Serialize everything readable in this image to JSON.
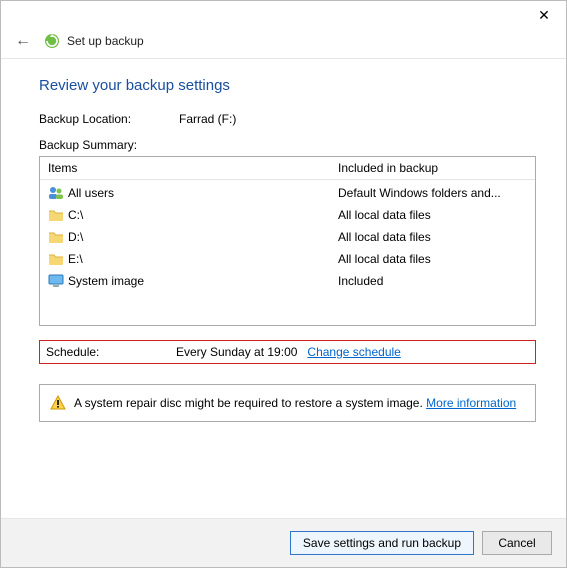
{
  "window": {
    "title": "Set up backup"
  },
  "page": {
    "title": "Review your backup settings",
    "location_label": "Backup Location:",
    "location_value": "Farrad (F:)",
    "summary_label": "Backup Summary:"
  },
  "columns": {
    "items": "Items",
    "included": "Included in backup"
  },
  "rows": [
    {
      "icon": "users-icon",
      "item": "All users",
      "included": "Default Windows folders and..."
    },
    {
      "icon": "folder-icon",
      "item": "C:\\",
      "included": "All local data files"
    },
    {
      "icon": "folder-icon",
      "item": "D:\\",
      "included": "All local data files"
    },
    {
      "icon": "folder-icon",
      "item": "E:\\",
      "included": "All local data files"
    },
    {
      "icon": "monitor-icon",
      "item": "System image",
      "included": "Included"
    }
  ],
  "schedule": {
    "label": "Schedule:",
    "value": "Every Sunday at 19:00",
    "change_link": "Change schedule"
  },
  "warning": {
    "text": "A system repair disc might be required to restore a system image.",
    "more_info": "More information"
  },
  "buttons": {
    "save": "Save settings and run backup",
    "cancel": "Cancel"
  }
}
